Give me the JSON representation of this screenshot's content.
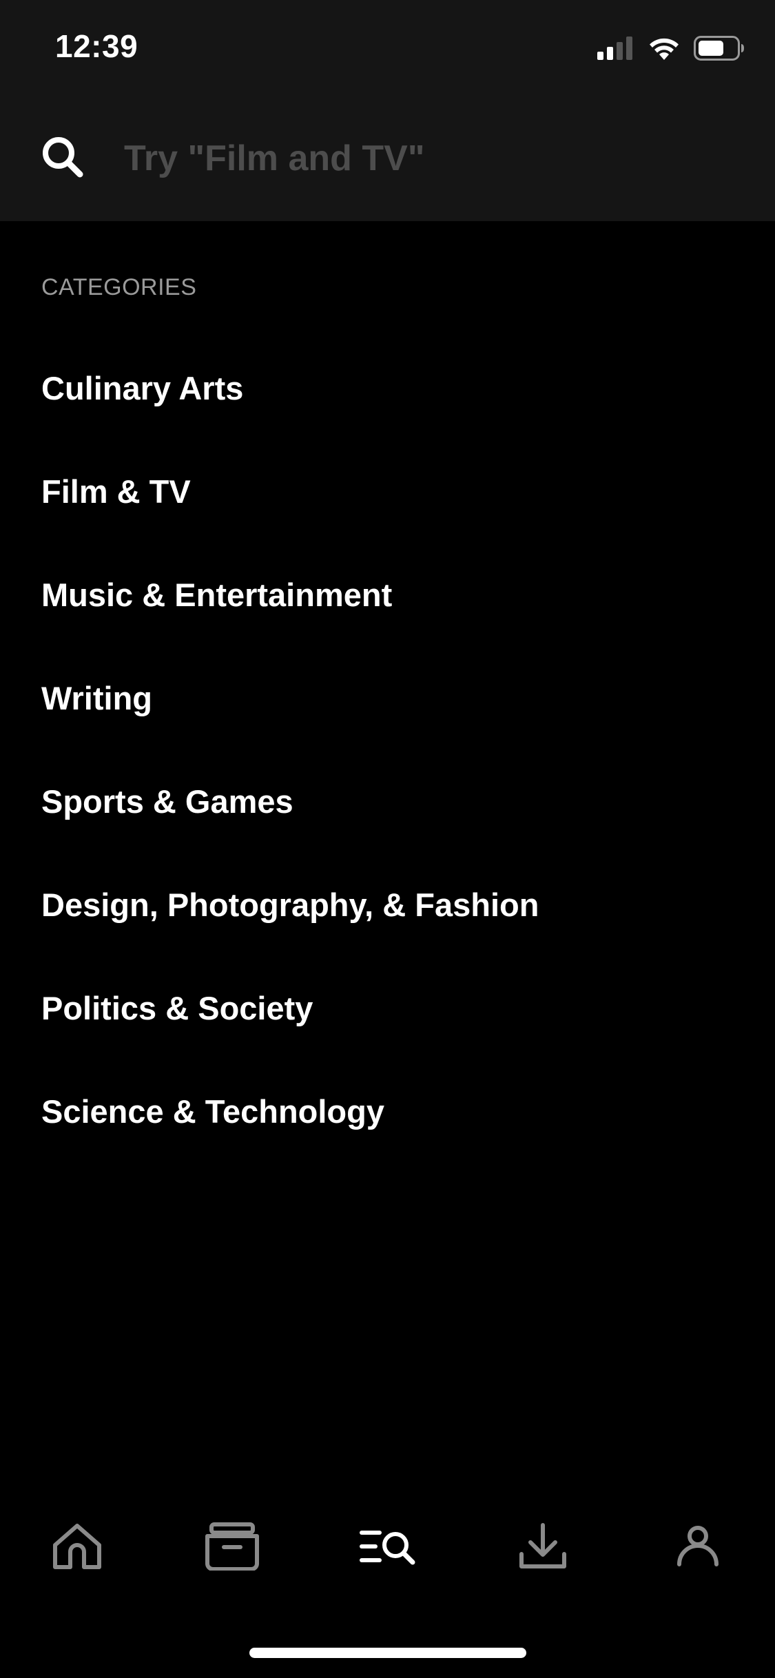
{
  "status_bar": {
    "time": "12:39",
    "icons": [
      "cellular-signal-icon",
      "wifi-icon",
      "battery-icon"
    ]
  },
  "search": {
    "placeholder": "Try \"Film and TV\"",
    "value": ""
  },
  "categories": {
    "heading": "CATEGORIES",
    "items": [
      "Culinary Arts",
      "Film & TV",
      "Music & Entertainment",
      "Writing",
      "Sports & Games",
      "Design, Photography, & Fashion",
      "Politics & Society",
      "Science & Technology"
    ]
  },
  "tab_bar": {
    "tabs": [
      {
        "icon": "home-icon",
        "active": false
      },
      {
        "icon": "library-box-icon",
        "active": false
      },
      {
        "icon": "browse-search-icon",
        "active": true
      },
      {
        "icon": "download-icon",
        "active": false
      },
      {
        "icon": "profile-icon",
        "active": false
      }
    ]
  },
  "colors": {
    "background": "#000000",
    "header_background": "#151515",
    "text_primary": "#ffffff",
    "text_secondary": "#9a9a9a",
    "placeholder": "#4d4d4d",
    "tab_inactive": "#8a8a8a",
    "tab_active": "#ffffff"
  }
}
